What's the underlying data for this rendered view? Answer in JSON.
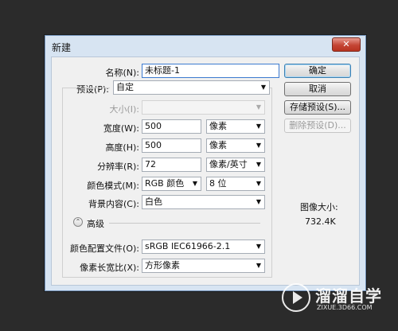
{
  "window": {
    "title": "新建",
    "close_label": "✕"
  },
  "form": {
    "name": {
      "label": "名称(N):",
      "value": "未标题-1"
    },
    "preset": {
      "label": "预设(P):",
      "value": "自定"
    },
    "size": {
      "label": "大小(I):",
      "value": ""
    },
    "width": {
      "label": "宽度(W):",
      "value": "500",
      "unit": "像素"
    },
    "height": {
      "label": "高度(H):",
      "value": "500",
      "unit": "像素"
    },
    "resolution": {
      "label": "分辨率(R):",
      "value": "72",
      "unit": "像素/英寸"
    },
    "color_mode": {
      "label": "颜色模式(M):",
      "value": "RGB 颜色",
      "depth": "8 位"
    },
    "background": {
      "label": "背景内容(C):",
      "value": "白色"
    },
    "advanced": {
      "label": "高级"
    },
    "color_profile": {
      "label": "颜色配置文件(O):",
      "value": "sRGB IEC61966-2.1"
    },
    "pixel_aspect": {
      "label": "像素长宽比(X):",
      "value": "方形像素"
    }
  },
  "buttons": {
    "ok": "确定",
    "cancel": "取消",
    "save_preset": "存储预设(S)...",
    "delete_preset": "删除预设(D)..."
  },
  "info": {
    "image_size_label": "图像大小:",
    "image_size_value": "732.4K"
  },
  "watermark": {
    "name": "溜溜自学",
    "url": "ZIXUE.3D66.COM"
  }
}
